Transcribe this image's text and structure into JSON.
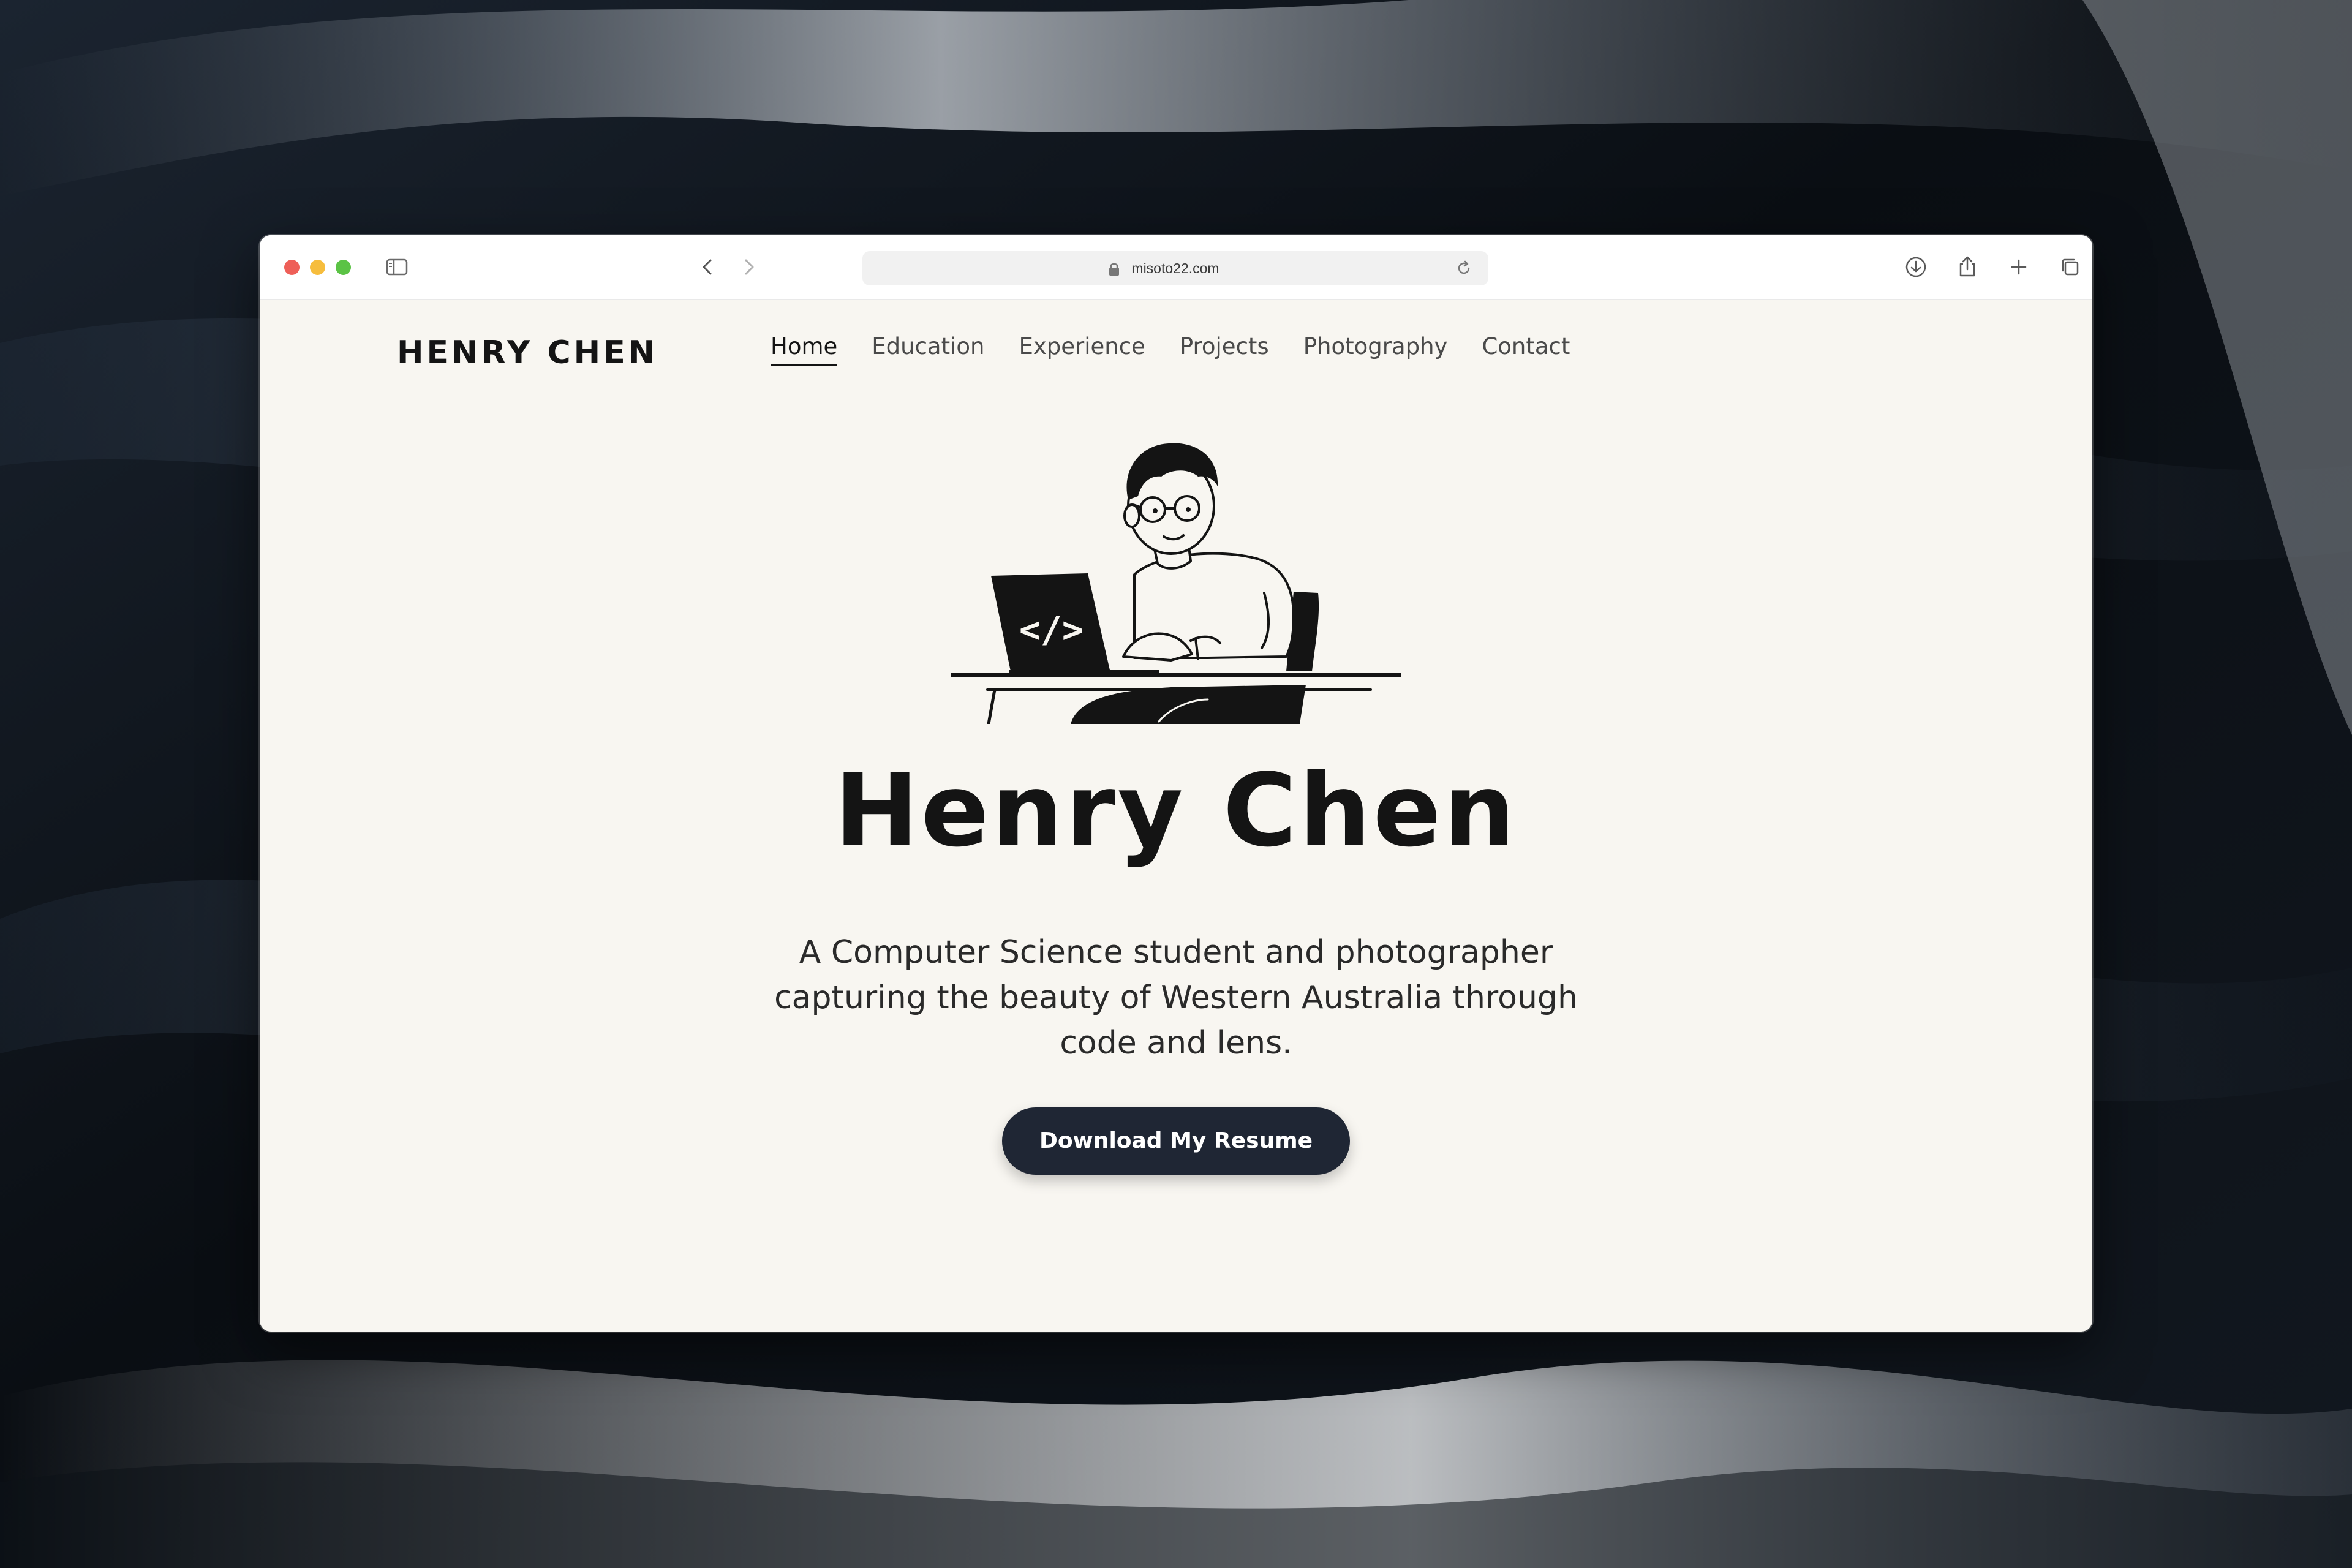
{
  "browser": {
    "url": "misoto22.com",
    "icons": {
      "window_controls": [
        "close-dot",
        "minimize-dot",
        "zoom-dot"
      ],
      "left": [
        "sidebar-icon",
        "back-icon",
        "forward-icon"
      ],
      "privacy": "shield-icon",
      "address": [
        "lock-icon",
        "reload-icon"
      ],
      "right": [
        "download-icon",
        "share-icon",
        "plus-icon",
        "tabs-overview-icon"
      ]
    }
  },
  "site": {
    "brand": "HENRY CHEN",
    "nav": [
      {
        "label": "Home",
        "active": true
      },
      {
        "label": "Education",
        "active": false
      },
      {
        "label": "Experience",
        "active": false
      },
      {
        "label": "Projects",
        "active": false
      },
      {
        "label": "Photography",
        "active": false
      },
      {
        "label": "Contact",
        "active": false
      }
    ],
    "hero": {
      "illustration": "person-coding-at-laptop-illustration",
      "laptop_glyph": "code-brackets-icon",
      "name": "Henry Chen",
      "tagline": "A Computer Science student and photographer capturing the beauty of Western Australia through code and lens.",
      "cta_label": "Download My Resume"
    }
  },
  "colors": {
    "page_background": "#f8f6f1",
    "text_primary": "#141414",
    "button_background": "#1f2634",
    "button_text": "#ffffff"
  }
}
